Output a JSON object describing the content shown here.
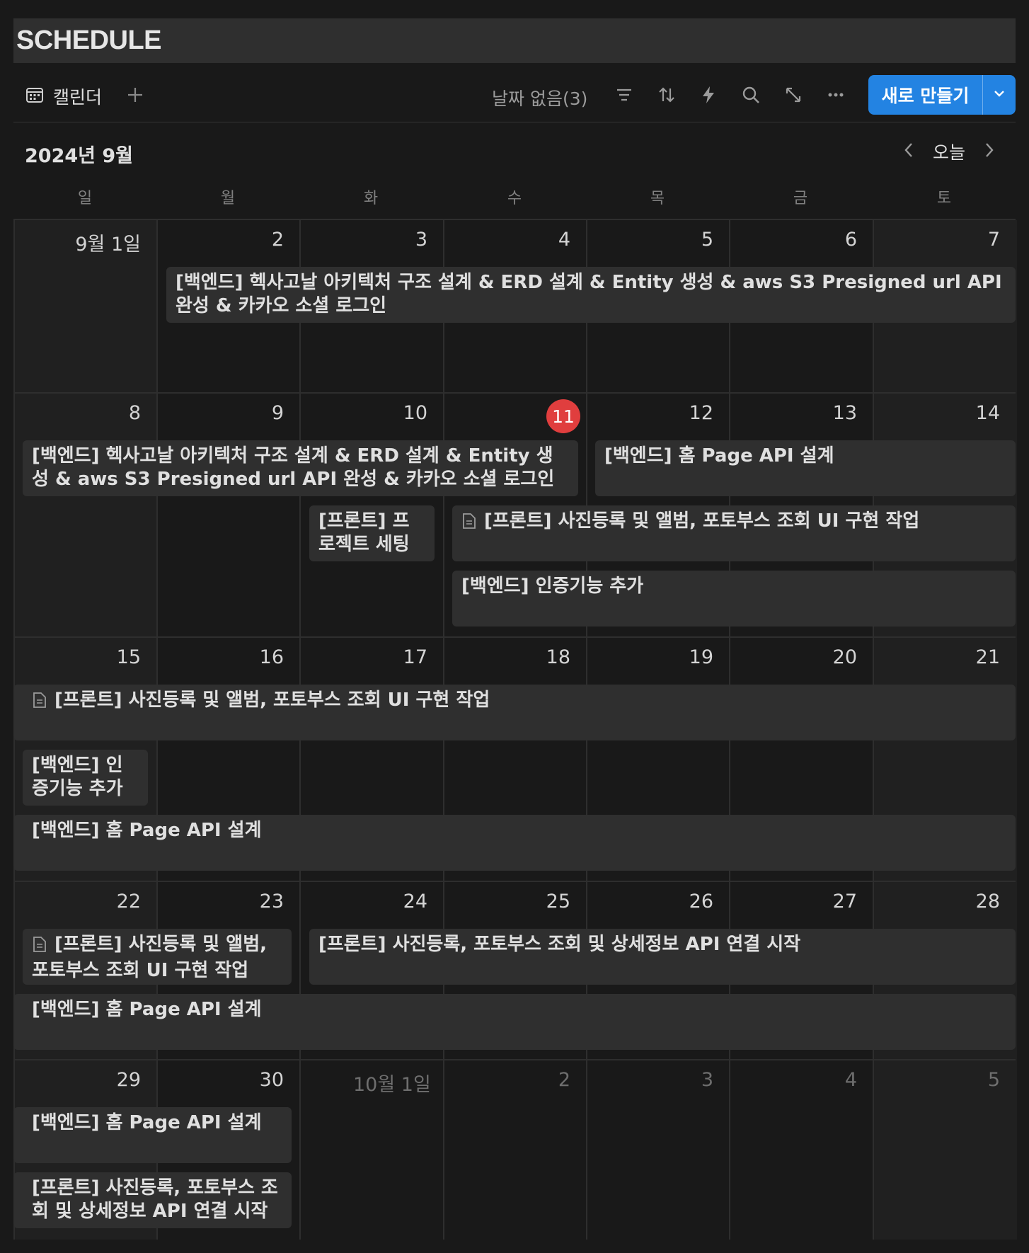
{
  "page": {
    "title": "SCHEDULE"
  },
  "toolbar": {
    "view_label": "캘린더",
    "no_date_label": "날짜 없음(3)",
    "new_button_label": "새로 만들기"
  },
  "header": {
    "month_label": "2024년 9월",
    "today_label": "오늘"
  },
  "weekdays": [
    "일",
    "월",
    "화",
    "수",
    "목",
    "금",
    "토"
  ],
  "weeks": [
    {
      "days": [
        "9월 1일",
        "2",
        "3",
        "4",
        "5",
        "6",
        "7"
      ]
    },
    {
      "days": [
        "8",
        "9",
        "10",
        "11",
        "12",
        "13",
        "14"
      ]
    },
    {
      "days": [
        "15",
        "16",
        "17",
        "18",
        "19",
        "20",
        "21"
      ]
    },
    {
      "days": [
        "22",
        "23",
        "24",
        "25",
        "26",
        "27",
        "28"
      ]
    },
    {
      "days": [
        "29",
        "30",
        "10월 1일",
        "2",
        "3",
        "4",
        "5"
      ]
    }
  ],
  "today_day": "11",
  "events": {
    "w1_e1": "[백엔드] 헥사고날 아키텍처 구조 설계 & ERD 설계 & Entity 생성 & aws S3 Presigned url API 완성 & 카카오 소셜 로그인",
    "w2_e1": "[백엔드] 헥사고날 아키텍처 구조 설계 & ERD 설계 & Entity 생성 & aws S3 Presigned url API 완성 & 카카오 소셜 로그인",
    "w2_e2": "[백엔드] 홈 Page API 설계",
    "w2_e3": "[프론트] 프로젝트 세팅",
    "w2_e4": "[프론트] 사진등록 및 앨범, 포토부스 조회 UI 구현 작업",
    "w2_e5": "[백엔드] 인증기능 추가",
    "w3_e1": "[프론트] 사진등록 및 앨범, 포토부스 조회 UI 구현 작업",
    "w3_e2": "[백엔드] 인증기능 추가",
    "w3_e3": "[백엔드] 홈 Page API 설계",
    "w4_e1": "[프론트] 사진등록 및 앨범, 포토부스 조회 UI 구현 작업",
    "w4_e2": "[프론트] 사진등록, 포토부스 조회 및 상세정보 API 연결 시작",
    "w4_e3": "[백엔드] 홈 Page API 설계",
    "w5_e1": "[백엔드] 홈 Page API 설계",
    "w5_e2": "[프론트] 사진등록, 포토부스 조회 및 상세정보 API 연결 시작"
  }
}
